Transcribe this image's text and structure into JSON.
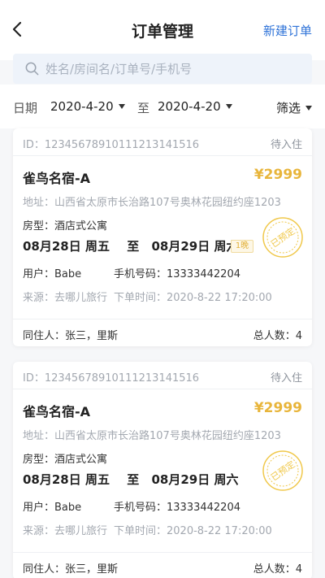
{
  "header": {
    "title": "订单管理",
    "new_order_label": "新建订单"
  },
  "search": {
    "placeholder": "姓名/房间名/订单号/手机号",
    "value": ""
  },
  "filter": {
    "date_label": "日期",
    "start_date": "2020-4-20",
    "separator": "至",
    "end_date": "2020-4-20",
    "filter_label": "筛选"
  },
  "orders": [
    {
      "id": "ID：12345678910111213141516",
      "status": "待入住",
      "name": "雀鸟名宿-A",
      "price": "¥2999",
      "address": "地址：山西省太原市长治路107号奥林花园纽约座1203",
      "room_type": "房型：酒店式公寓",
      "check_in": "08月28日 周五",
      "to": "至",
      "check_out": "08月29日 周六",
      "nights": "1晚",
      "user": "用户：Babe",
      "phone": "手机号码：13333442204",
      "source": "来源：去哪儿旅行",
      "order_time": "下单时间：2020-8-22 17:20:00",
      "stamp_text": "已预定",
      "co_guests": "同住人：张三，里斯",
      "total": "总人数：4"
    },
    {
      "id": "ID：12345678910111213141516",
      "status": "待入住",
      "name": "雀鸟名宿-A",
      "price": "¥2999",
      "address": "地址：山西省太原市长治路107号奥林花园纽约座1203",
      "room_type": "房型：酒店式公寓",
      "check_in": "08月28日 周五",
      "to": "至",
      "check_out": "08月29日 周六",
      "nights": "1晚",
      "user": "用户：Babe",
      "phone": "手机号码：13333442204",
      "source": "来源：去哪儿旅行",
      "order_time": "下单时间：2020-8-22 17:20:00",
      "stamp_text": "已预定",
      "co_guests": "同住人：张三，里斯",
      "total": "总人数：4"
    }
  ],
  "colors": {
    "accent": "#2f73d8",
    "price": "#e8b53b",
    "stamp": "#f0c84a"
  }
}
